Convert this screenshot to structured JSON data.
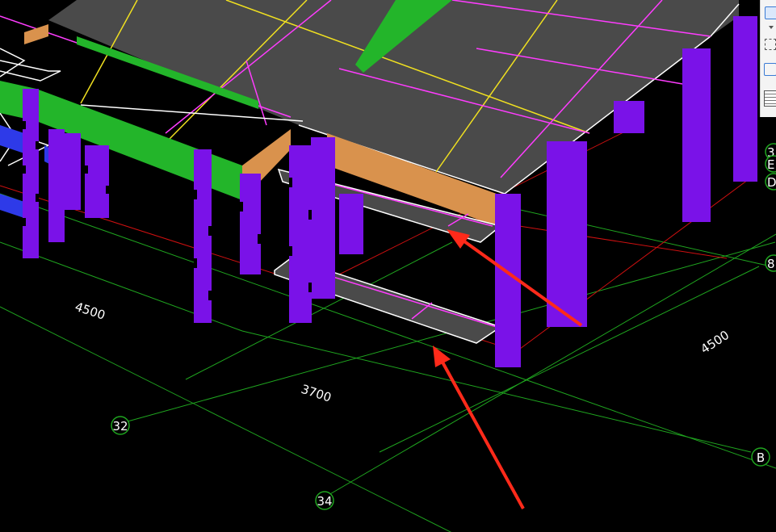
{
  "viewport": {
    "dimensions": [
      "4500",
      "3700",
      "4500"
    ],
    "grid_axes": [
      "32",
      "34",
      "B"
    ],
    "partial_axis_labels": [
      "3",
      "E",
      "D",
      "8"
    ]
  },
  "toolbar": {
    "icons": [
      "cube-icon",
      "view-icon",
      "list-icon"
    ]
  },
  "colors": {
    "background": "#000000",
    "slab": "#4a4a4a",
    "slab_edge": "#ffffff",
    "column": "#7a12e8",
    "beam_green": "#23b52a",
    "beam_orange": "#d9924d",
    "beam_blue": "#2e3ae8",
    "grid_green": "#1fa51f",
    "grid_red": "#d01010",
    "rebar_yellow": "#f0e020",
    "rebar_magenta": "#ff3cff",
    "annotation_arrow": "#ff2a1a"
  }
}
